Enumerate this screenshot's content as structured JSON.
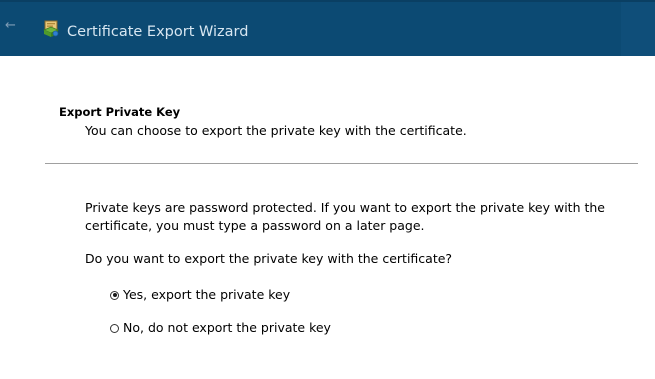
{
  "window": {
    "title": "Certificate Export Wizard",
    "back_icon": "back-arrow-icon",
    "app_icon": "certificate-icon",
    "titlebar_color": "#0c4a73"
  },
  "section": {
    "heading": "Export Private Key",
    "subheading": "You can choose to export the private key with the certificate."
  },
  "body": {
    "line1": "Private keys are password protected. If you want to export the private key with the",
    "line2": "certificate, you must type a password on a later page.",
    "question": "Do you want to export the private key with the certificate?"
  },
  "options": [
    {
      "label": "Yes, export the private key",
      "selected": true
    },
    {
      "label": "No, do not export the private key",
      "selected": false
    }
  ]
}
